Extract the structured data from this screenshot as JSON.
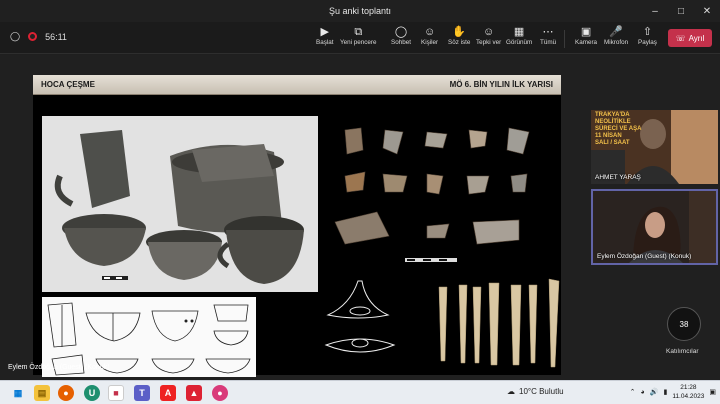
{
  "window": {
    "title": "Şu anki toplantı",
    "controls": [
      "minimize",
      "maximize",
      "close"
    ]
  },
  "meeting": {
    "timer": "56:11"
  },
  "toolbar": {
    "items": [
      {
        "label": "Başlat",
        "icon": "start-icon"
      },
      {
        "label": "Yeni pencere",
        "icon": "new-window-icon"
      },
      {
        "label": "Sohbet",
        "icon": "chat-icon"
      },
      {
        "label": "Kişiler",
        "icon": "people-icon"
      },
      {
        "label": "Söz iste",
        "icon": "raise-hand-icon"
      },
      {
        "label": "Tepki ver",
        "icon": "react-icon"
      },
      {
        "label": "Görünüm",
        "icon": "view-icon"
      },
      {
        "label": "Tümü",
        "icon": "more-icon"
      },
      {
        "label": "Kamera",
        "icon": "camera-off-icon"
      },
      {
        "label": "Mikrofon",
        "icon": "mic-off-icon"
      },
      {
        "label": "Paylaş",
        "icon": "share-icon"
      }
    ],
    "leave_label": "Ayrıl"
  },
  "slide": {
    "left_title": "HOCA ÇEŞME",
    "right_title": "MÖ 6. BİN YILIN İLK YARISI"
  },
  "participants": [
    {
      "name": "AHMET YARAŞ",
      "poster_lines": [
        "TRAKYA'DA",
        "NEOLİTİKLE",
        "SÜRECİ VE AŞA",
        "11 NİSAN",
        "SALI / SAAT"
      ]
    },
    {
      "name": "Eylem Özdoğan (Guest) (Konuk)",
      "active": true
    }
  ],
  "people_count": "38",
  "people_label": "Katılımcılar",
  "presenter_caption": "Eylem Özdoğan (Guest) (Konuk)",
  "taskbar": {
    "weather": "10°C  Bulutlu",
    "time": "21:28",
    "date": "11.04.2023"
  }
}
